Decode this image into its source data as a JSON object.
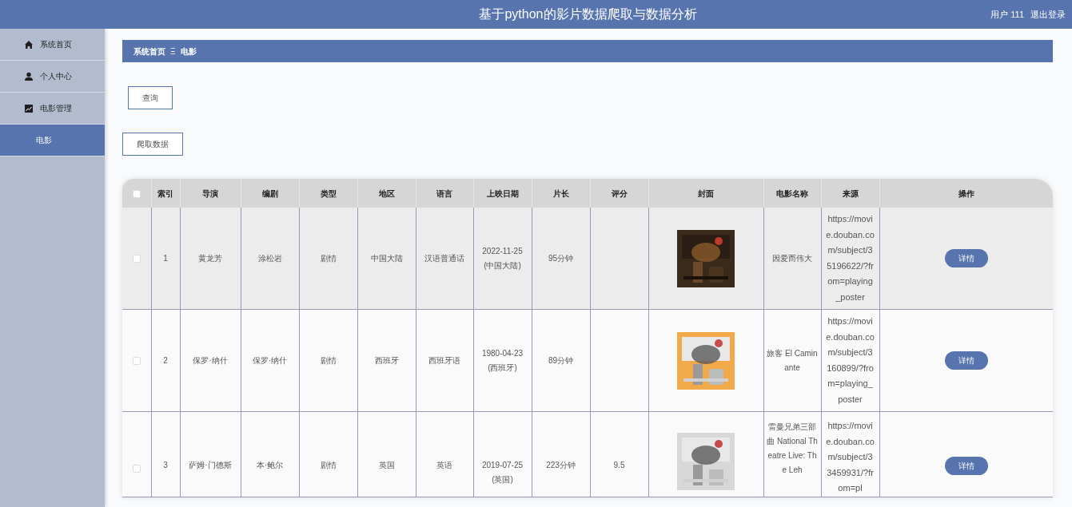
{
  "header": {
    "title": "基于python的影片数据爬取与数据分析",
    "user": "用户 111",
    "logout": "退出登录"
  },
  "sidebar": {
    "items": [
      {
        "label": "系统首页",
        "kind": "home",
        "selected": false
      },
      {
        "label": "个人中心",
        "kind": "user",
        "selected": false
      },
      {
        "label": "电影管理",
        "kind": "chart",
        "selected": false
      },
      {
        "label": "电影",
        "kind": "sub",
        "selected": true
      }
    ]
  },
  "breadcrumb": [
    "系统首页",
    "电影"
  ],
  "breadcrumb_separator": "Ξ",
  "buttons": [
    "查询",
    "爬取数据"
  ],
  "table": {
    "header_checkbox": {
      "checked": false
    },
    "columns": [
      "索引",
      "导演",
      "编剧",
      "类型",
      "地区",
      "语言",
      "上映日期",
      "片长",
      "评分",
      "封面",
      "电影名称",
      "来源",
      "操作"
    ],
    "rows": [
      {
        "checked": false,
        "highlighted": true,
        "index": "1",
        "director": "黄龙芳",
        "writer": "涂松岩",
        "genre": "剧情",
        "region": "中国大陆",
        "language": "汉语普通话",
        "release": "2022-11-25 (中国大陆)",
        "duration": "95分钟",
        "title": "因爱而伟大",
        "source": "https://movie.douban.com/subject/35196622/?from=playing_poster",
        "action": "详情"
      },
      {
        "checked": false,
        "highlighted": false,
        "index": "2",
        "director": "保罗·纳什",
        "writer": "保罗·纳什",
        "genre": "剧情",
        "region": "西班牙",
        "language": "西班牙语",
        "release": "1980-04-23 (西班牙)",
        "duration": "89分钟",
        "title": "旅客 El Caminante",
        "source": "https://movie.douban.com/subject/3160899/?from=playing_poster",
        "action": "详情"
      },
      {
        "checked": false,
        "highlighted": false,
        "index": "3",
        "director": "萨姆·门德斯",
        "writer": "本·鲍尔",
        "genre": "剧情",
        "region": "英国",
        "language": "英语",
        "release": "2019-07-25 (英国)",
        "duration": "223分钟",
        "rating": "9.5",
        "title": "雷曼兄弟三部曲 National Theatre Live: The Leh",
        "source": "https://movie.douban.com/subject/33459931/?from=pl",
        "action": "详情"
      }
    ]
  }
}
